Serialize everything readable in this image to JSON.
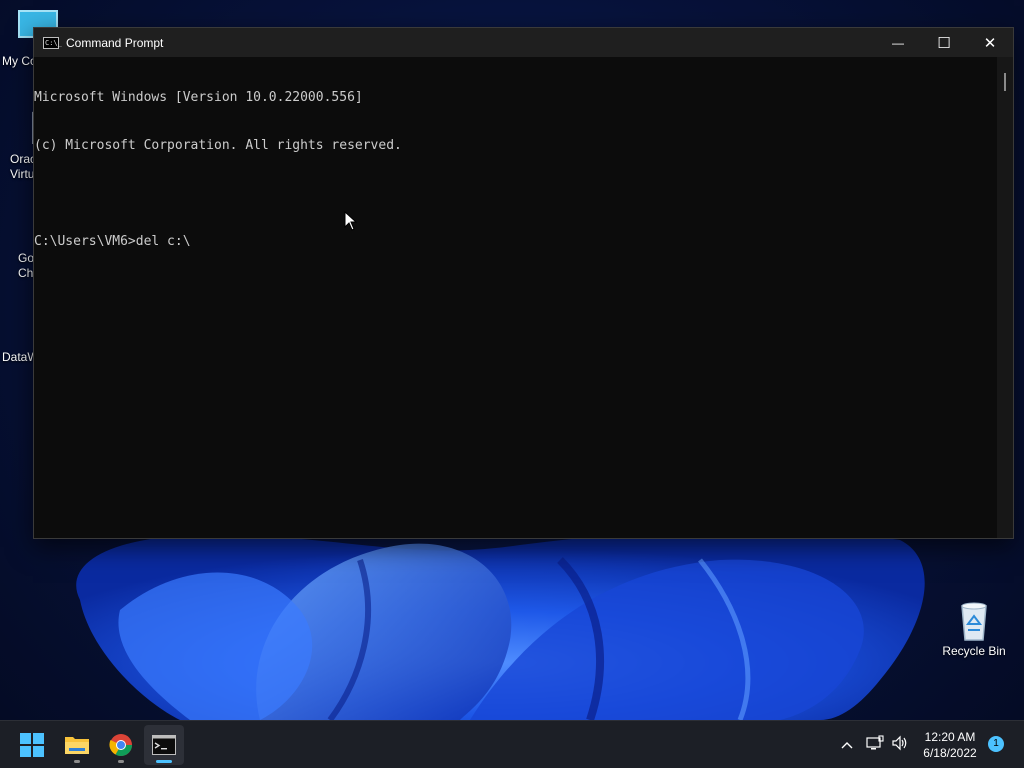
{
  "desktop": {
    "icons": [
      {
        "label": "My Co"
      },
      {
        "label": "Orac\nVirtu"
      },
      {
        "label": "Go\nChr"
      },
      {
        "label": "DataW"
      },
      {
        "label": "Recycle Bin"
      }
    ]
  },
  "cmd_window": {
    "title": "Command Prompt",
    "title_icon_text": "C:\\_",
    "controls": {
      "minimize": "—",
      "maximize": "☐",
      "close": "✕"
    },
    "console_lines": [
      "Microsoft Windows [Version 10.0.22000.556]",
      "(c) Microsoft Corporation. All rights reserved.",
      "",
      "C:\\Users\\VM6>del c:\\"
    ]
  },
  "taskbar": {
    "apps": [
      {
        "name": "start-button"
      },
      {
        "name": "file-explorer"
      },
      {
        "name": "google-chrome"
      },
      {
        "name": "command-prompt"
      }
    ],
    "clock": {
      "time": "12:20 AM",
      "date": "6/18/2022"
    },
    "notification_count": "1"
  },
  "colors": {
    "accent": "#4cc2ff",
    "console_text": "#cccccc",
    "console_bg": "#0c0c0c"
  }
}
